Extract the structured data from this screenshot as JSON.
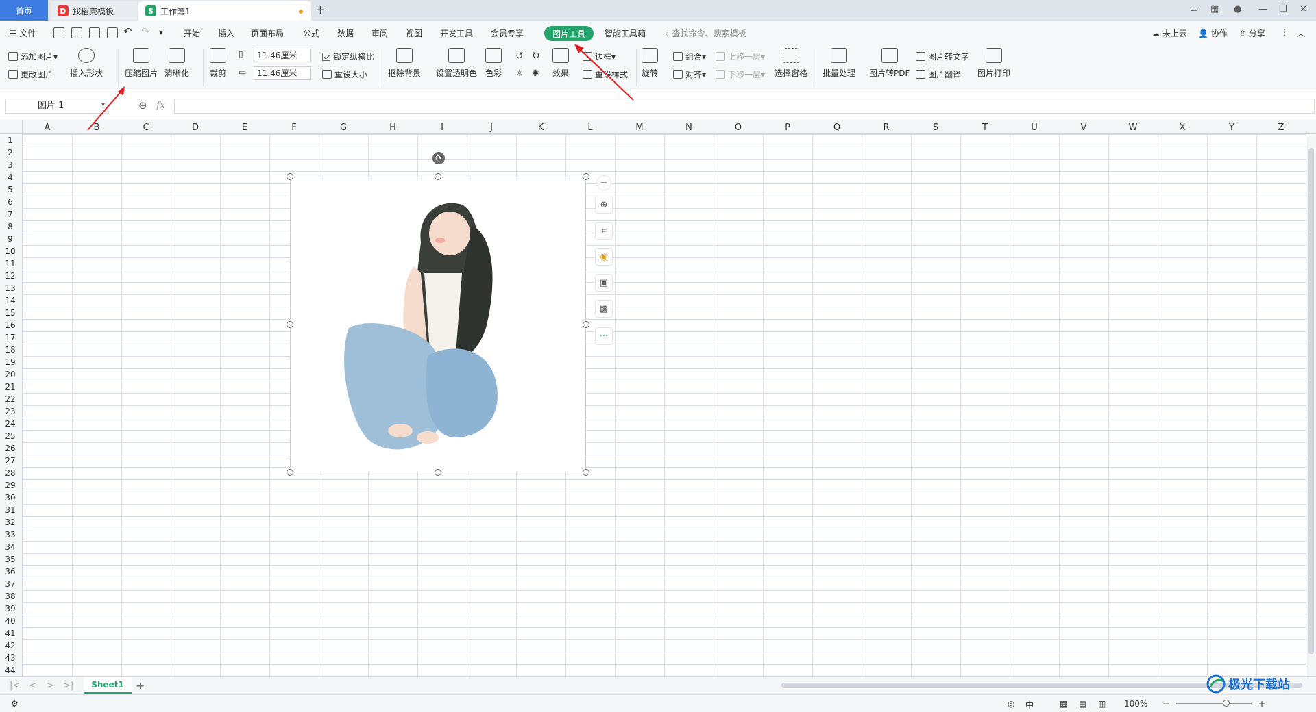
{
  "titlebar": {
    "tabs": [
      {
        "label": "首页"
      },
      {
        "label": "找稻壳模板"
      },
      {
        "label": "工作簿1"
      }
    ]
  },
  "menubar": {
    "file": "文件",
    "items": [
      "开始",
      "插入",
      "页面布局",
      "公式",
      "数据",
      "审阅",
      "视图",
      "开发工具",
      "会员专享",
      "图片工具",
      "智能工具箱"
    ],
    "search_placeholder": "查找命令、搜索模板",
    "right": [
      "未上云",
      "协作",
      "分享"
    ]
  },
  "ribbon": {
    "add_picture": "添加图片",
    "change_picture": "更改图片",
    "insert_shape": "插入形状",
    "compress_picture": "压缩图片",
    "sharpen": "清晰化",
    "crop": "裁剪",
    "width_value": "11.46厘米",
    "height_value": "11.46厘米",
    "lock_ratio": "锁定纵横比",
    "reset_size": "重设大小",
    "remove_bg": "抠除背景",
    "set_transparent": "设置透明色",
    "color": "色彩",
    "effects": "效果",
    "border": "边框",
    "reset_style": "重设样式",
    "rotate": "旋转",
    "group": "组合",
    "align": "对齐",
    "bring_forward": "上移一层",
    "send_backward": "下移一层",
    "selection_pane": "选择窗格",
    "batch": "批量处理",
    "to_pdf": "图片转PDF",
    "to_text": "图片转文字",
    "translate": "图片翻译",
    "print": "图片打印"
  },
  "formulabar": {
    "name_box": "图片 1",
    "fx": "fx"
  },
  "grid": {
    "columns": [
      "A",
      "B",
      "C",
      "D",
      "E",
      "F",
      "G",
      "H",
      "I",
      "J",
      "K",
      "L",
      "M",
      "N",
      "O",
      "P",
      "Q",
      "R",
      "S",
      "T",
      "U",
      "V",
      "W",
      "X",
      "Y",
      "Z"
    ],
    "rows": [
      "1",
      "2",
      "3",
      "4",
      "5",
      "6",
      "7",
      "8",
      "9",
      "10",
      "11",
      "12",
      "13",
      "14",
      "15",
      "16",
      "17",
      "18",
      "19",
      "20",
      "21",
      "22",
      "23",
      "24",
      "25",
      "26",
      "27",
      "28",
      "29",
      "30",
      "31",
      "32",
      "33",
      "34",
      "35",
      "36",
      "37",
      "38",
      "39",
      "40",
      "41",
      "42",
      "43",
      "44"
    ]
  },
  "sheets": {
    "active": "Sheet1"
  },
  "statusbar": {
    "input_mode": "中",
    "zoom": "100%"
  },
  "watermark": {
    "text": "极光下载站"
  },
  "colors": {
    "accent": "#24a36b",
    "home_tab": "#3d7be0",
    "annotation_arrow": "#e02020"
  }
}
